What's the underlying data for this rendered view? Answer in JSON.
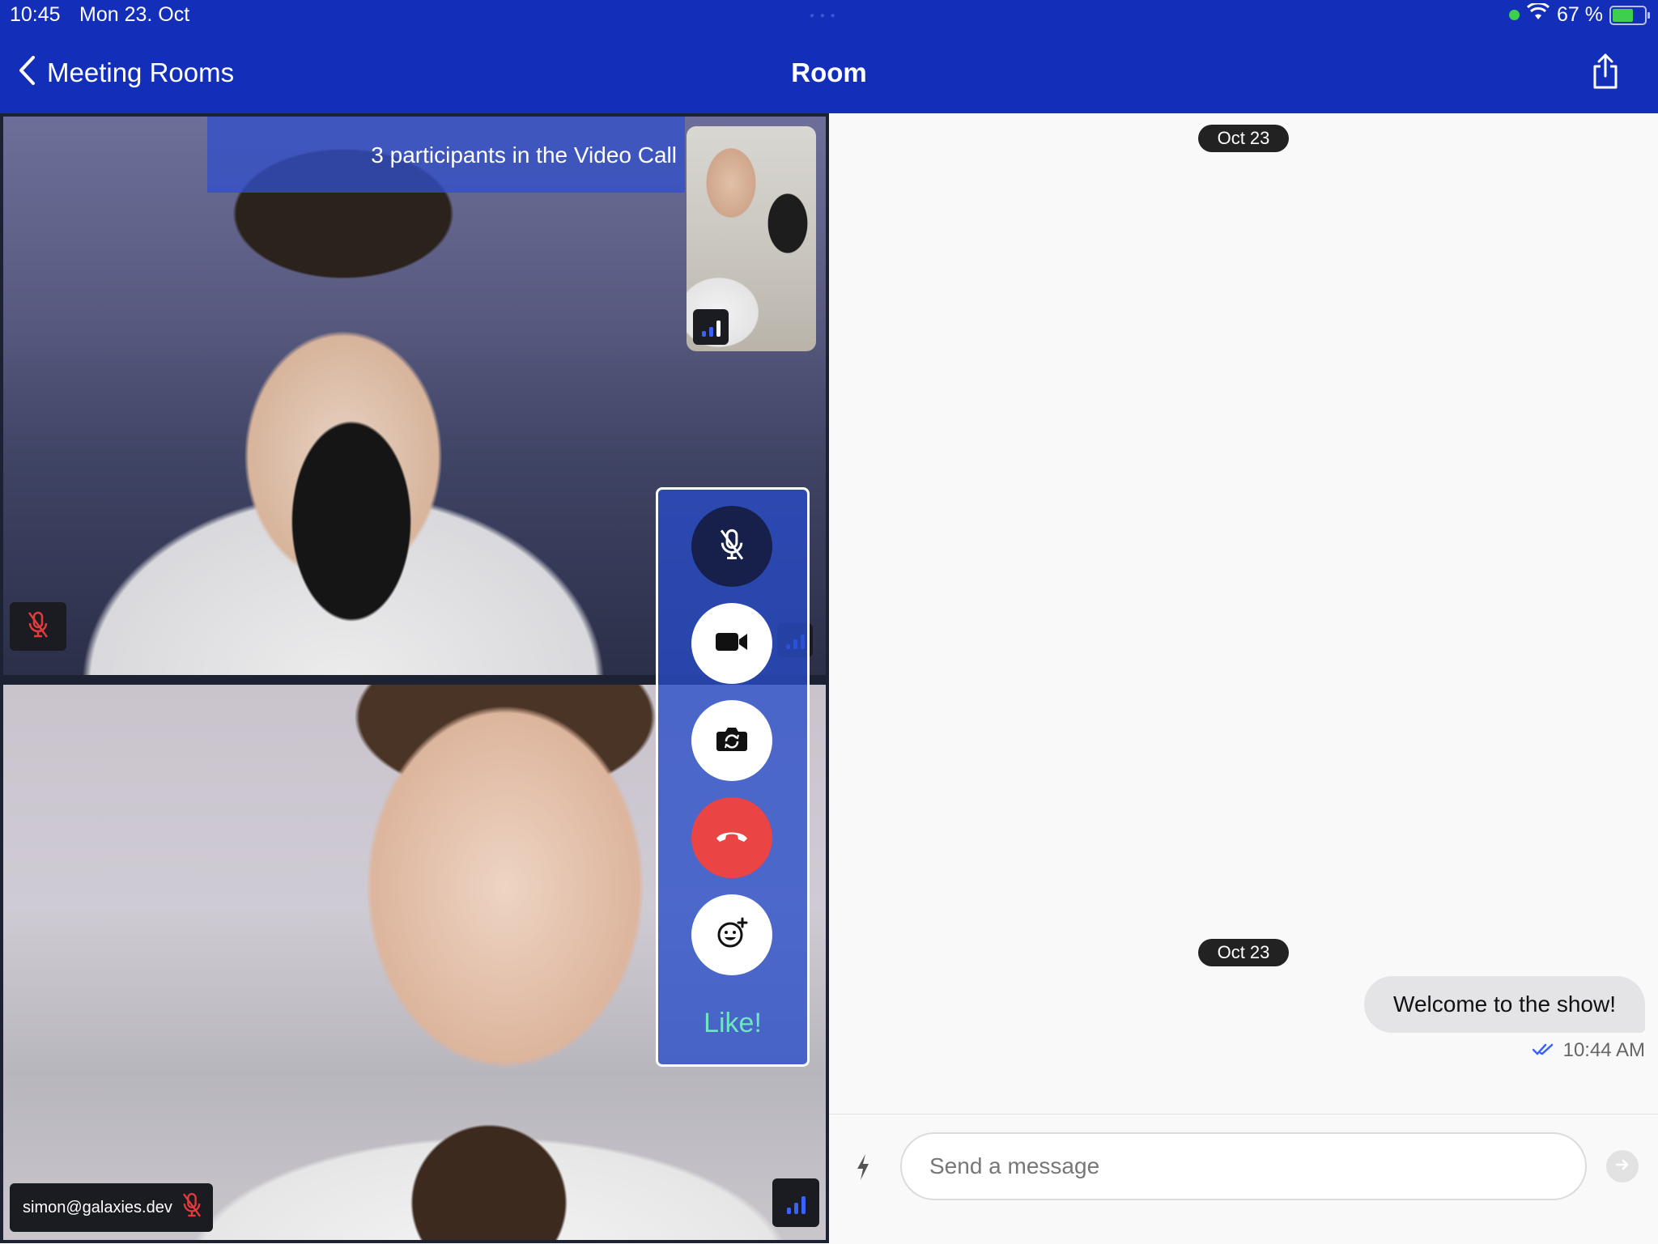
{
  "status_bar": {
    "time": "10:45",
    "date": "Mon 23. Oct",
    "battery": "67 %"
  },
  "nav": {
    "back_label": "Meeting Rooms",
    "title": "Room"
  },
  "video": {
    "banner": "3 participants in the Video Call",
    "participant_tag": "simon@galaxies.dev",
    "like_label": "Like!"
  },
  "chat": {
    "date_pills": [
      "Oct 23",
      "Oct 23"
    ],
    "messages": [
      {
        "text": "Welcome to the show!",
        "time": "10:44 AM"
      }
    ],
    "input_placeholder": "Send a message"
  },
  "colors": {
    "header_blue": "#132fba",
    "hangup_red": "#ea4444",
    "like_green": "#6ee6c2"
  }
}
